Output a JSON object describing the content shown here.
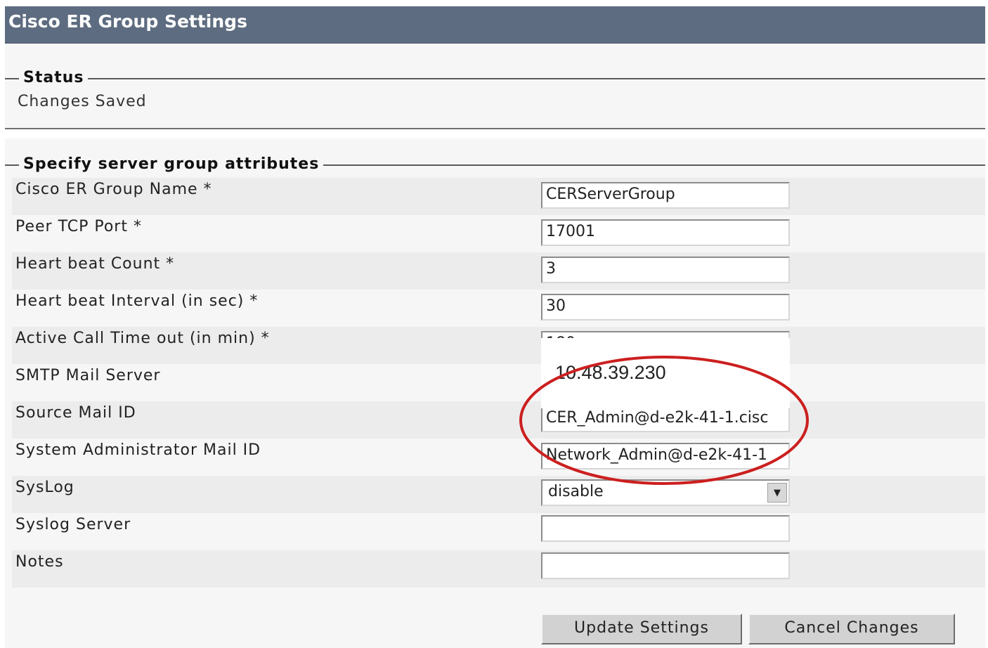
{
  "header": {
    "title": "Cisco ER Group Settings"
  },
  "status": {
    "legend": "Status",
    "message": "Changes Saved"
  },
  "attributes": {
    "legend": "Specify server group attributes",
    "group_name": {
      "label": "Cisco ER Group Name *",
      "value": "CERServerGroup"
    },
    "peer_tcp_port": {
      "label": "Peer TCP Port *",
      "value": "17001"
    },
    "heartbeat_count": {
      "label": "Heart beat Count *",
      "value": "3"
    },
    "heartbeat_interval": {
      "label": "Heart beat Interval (in sec) *",
      "value": "30"
    },
    "active_call_timeout": {
      "label": "Active Call Time out (in min) *",
      "value": "180"
    },
    "smtp_server": {
      "label": "SMTP Mail Server",
      "value": "10.48.39.230"
    },
    "source_mail_id": {
      "label": "Source Mail ID",
      "value": "CER_Admin@d-e2k-41-1.cisc"
    },
    "sysadmin_mail_id": {
      "label": "System Administrator Mail ID",
      "value": "Network_Admin@d-e2k-41-1"
    },
    "syslog": {
      "label": "SysLog",
      "value": "disable"
    },
    "syslog_server": {
      "label": "Syslog Server",
      "value": ""
    },
    "notes": {
      "label": "Notes",
      "value": ""
    }
  },
  "annotation": {
    "color": "#cc1f1f"
  },
  "buttons": {
    "update": "Update Settings",
    "cancel": "Cancel Changes"
  }
}
